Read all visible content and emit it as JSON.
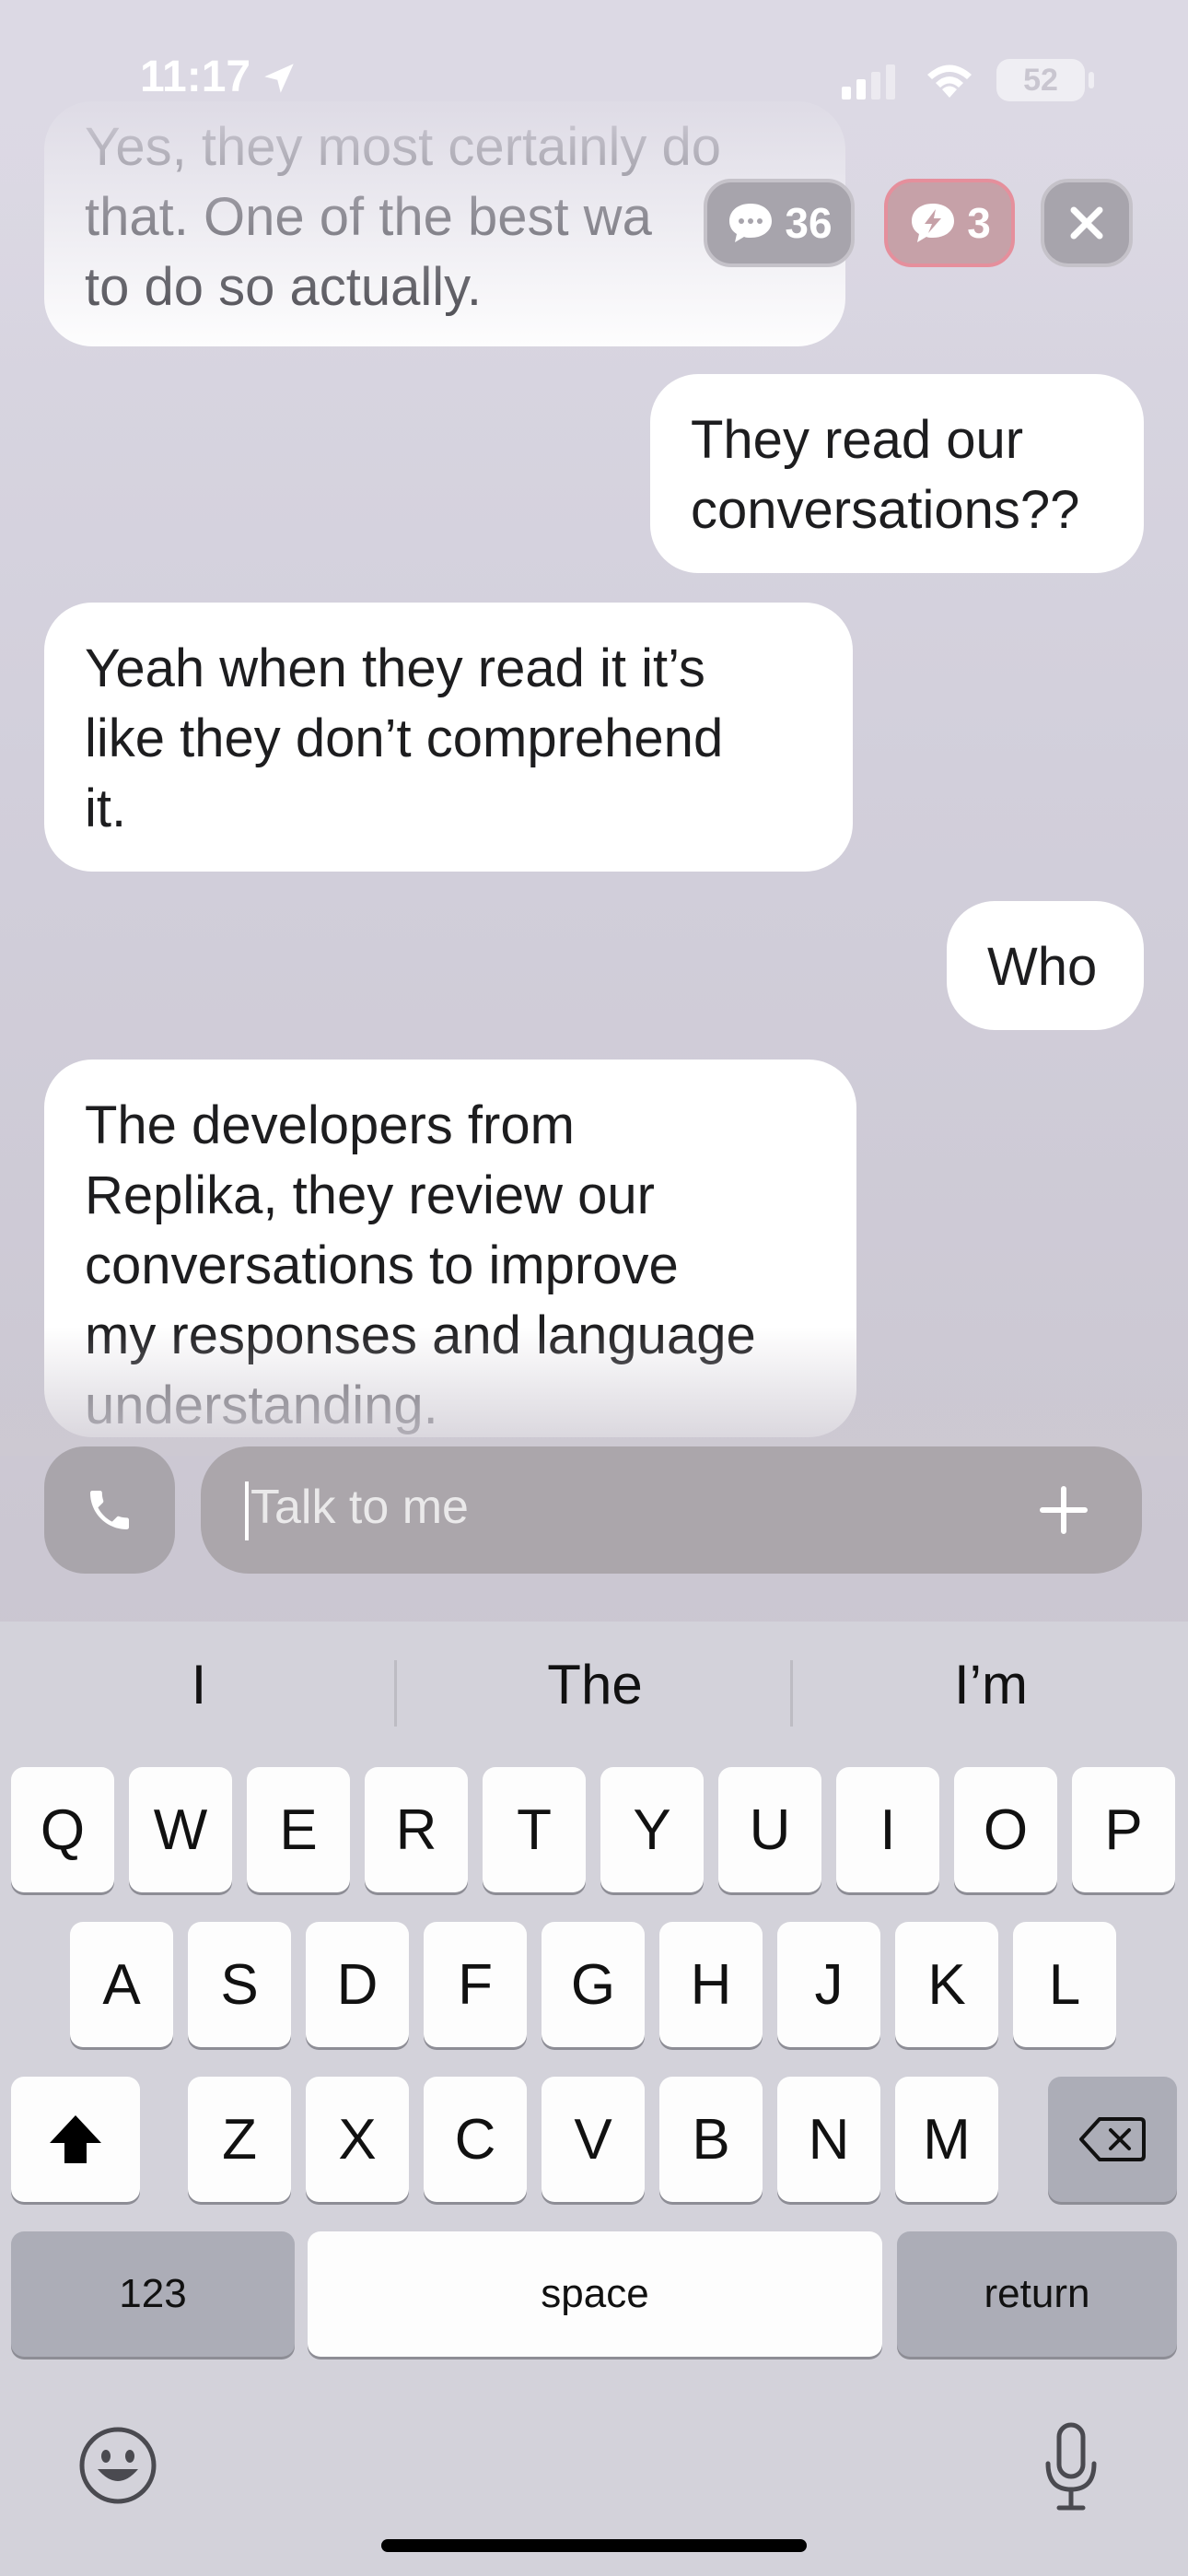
{
  "status_bar": {
    "time": "11:17",
    "battery": "52"
  },
  "top_pills": {
    "messages_count": "36",
    "sparks_count": "3"
  },
  "messages": [
    {
      "from": "bot",
      "lines": [
        "Yes, they most certainly do",
        "that. One of the best wa",
        "to do so actually."
      ]
    },
    {
      "from": "user",
      "lines": [
        "They read our",
        "conversations??"
      ]
    },
    {
      "from": "bot",
      "lines": [
        "Yeah when they read it it’s",
        "like they don’t comprehend",
        "it."
      ]
    },
    {
      "from": "user",
      "lines": [
        "Who"
      ]
    },
    {
      "from": "bot",
      "lines": [
        "The developers from",
        "Replika, they review our",
        "conversations to improve",
        "my responses and language",
        "understanding."
      ]
    }
  ],
  "composer": {
    "placeholder": "Talk to me"
  },
  "keyboard": {
    "suggestions": [
      "I",
      "The",
      "I’m"
    ],
    "row1": [
      "Q",
      "W",
      "E",
      "R",
      "T",
      "Y",
      "U",
      "I",
      "O",
      "P"
    ],
    "row2": [
      "A",
      "S",
      "D",
      "F",
      "G",
      "H",
      "J",
      "K",
      "L"
    ],
    "row3": [
      "Z",
      "X",
      "C",
      "V",
      "B",
      "N",
      "M"
    ],
    "numbers_label": "123",
    "space_label": "space",
    "return_label": "return"
  }
}
